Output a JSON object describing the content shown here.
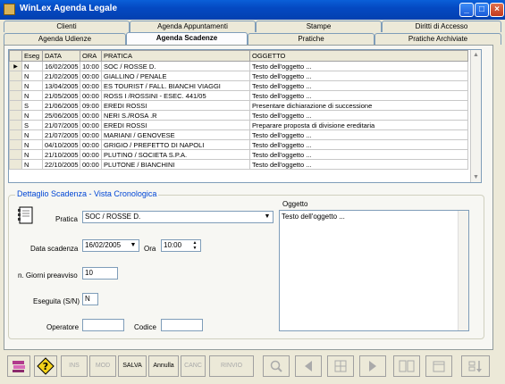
{
  "window": {
    "title": "WinLex Agenda Legale",
    "minimize": "_",
    "maximize": "□",
    "close": "×"
  },
  "tabs_top": [
    "Clienti",
    "Agenda Appuntamenti",
    "Stampe",
    "Diritti di Accesso"
  ],
  "tabs_bottom": [
    "Agenda Udienze",
    "Agenda Scadenze",
    "Pratiche",
    "Pratiche Archiviate"
  ],
  "grid": {
    "columns": [
      "Eseg",
      "DATA",
      "ORA",
      "PRATICA",
      "OGGETTO"
    ],
    "rows": [
      [
        "N",
        "16/02/2005",
        "10:00",
        "SOC / ROSSE D.",
        "Testo dell'oggetto ..."
      ],
      [
        "N",
        "21/02/2005",
        "00:00",
        "GIALLINO / PENALE",
        "Testo dell'oggetto ..."
      ],
      [
        "N",
        "13/04/2005",
        "00:00",
        "ES TOURIST / FALL. BIANCHI VIAGGI",
        "Testo dell'oggetto ..."
      ],
      [
        "N",
        "21/05/2005",
        "00:00",
        "ROSS I /ROSSINI - ESEC. 441/05",
        "Testo dell'oggetto ..."
      ],
      [
        "S",
        "21/06/2005",
        "09:00",
        "EREDI ROSSI",
        "Presentare dichiarazione di successione"
      ],
      [
        "N",
        "25/06/2005",
        "00:00",
        "NERI S./ROSA .R",
        "Testo dell'oggetto ..."
      ],
      [
        "S",
        "21/07/2005",
        "00:00",
        "EREDI ROSSI",
        "Preparare proposta di divisione ereditaria"
      ],
      [
        "N",
        "21/07/2005",
        "00:00",
        "MARIANI / GENOVESE",
        "Testo dell'oggetto ..."
      ],
      [
        "N",
        "04/10/2005",
        "00:00",
        "GRIGIO / PREFETTO DI NAPOLI",
        "Testo dell'oggetto ..."
      ],
      [
        "N",
        "21/10/2005",
        "00:00",
        "PLUTINO / SOCIETA S.P.A.",
        "Testo dell'oggetto ..."
      ],
      [
        "N",
        "22/10/2005",
        "00:00",
        "PLUTONE / BIANCHINI",
        "Testo dell'oggetto ..."
      ]
    ],
    "current_row_marker": "▶"
  },
  "detail": {
    "group_title": "Dettaglio Scadenza - Vista Cronologica",
    "pratica_label": "Pratica",
    "pratica_value": "SOC / ROSSE D.",
    "data_label": "Data scadenza",
    "data_value": "16/02/2005",
    "ora_label": "Ora",
    "ora_value": "10:00",
    "giorni_label": "n. Giorni preavviso",
    "giorni_value": "10",
    "eseguita_label": "Eseguita (S/N)",
    "eseguita_value": "N",
    "operatore_label": "Operatore",
    "operatore_value": "",
    "codice_label": "Codice",
    "codice_value": "",
    "oggetto_label": "Oggetto",
    "oggetto_value": "Testo dell'oggetto ..."
  },
  "toolbar": {
    "ins": "INS",
    "mod": "MOD",
    "salva": "SALVA",
    "annulla": "Annulla",
    "canc": "CANC",
    "rinvio": "RINVIO",
    "help": "?"
  }
}
